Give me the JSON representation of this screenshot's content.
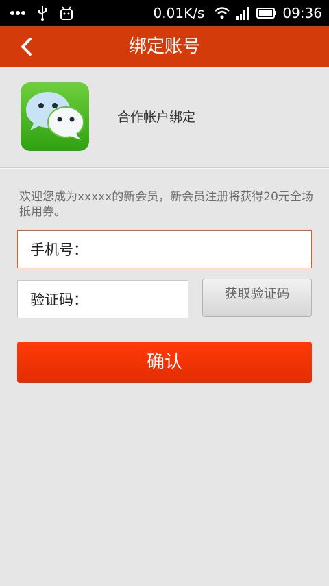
{
  "status_bar": {
    "speed": "0.01K/s",
    "time": "09:36"
  },
  "header": {
    "title": "绑定账号"
  },
  "account": {
    "label": "合作帐户绑定"
  },
  "welcome_text": "欢迎您成为xxxxx的新会员，新会员注册将获得20元全场抵用券。",
  "form": {
    "phone_label": "手机号：",
    "code_label": "验证码：",
    "get_code_button": "获取验证码",
    "confirm_button": "确认"
  },
  "colors": {
    "header": "#d33b0b",
    "confirm": "#ff3a0a",
    "phone_border": "#e05a33"
  }
}
